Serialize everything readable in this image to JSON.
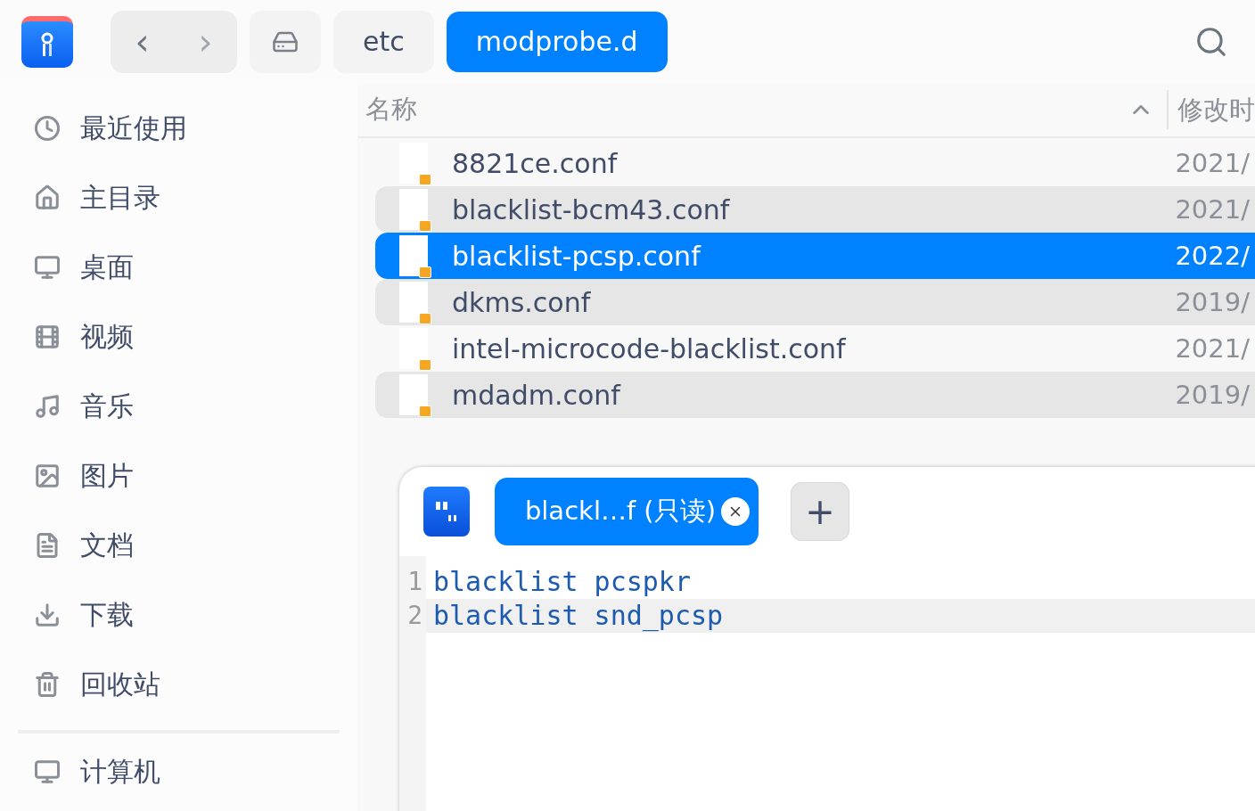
{
  "toolbar": {
    "back": "‹",
    "forward": "›",
    "breadcrumbs": [
      {
        "label": "etc",
        "selected": false
      },
      {
        "label": "modprobe.d",
        "selected": true
      }
    ]
  },
  "sidebar": {
    "items": [
      {
        "kind": "recent",
        "label": "最近使用"
      },
      {
        "kind": "home",
        "label": "主目录"
      },
      {
        "kind": "desktop",
        "label": "桌面"
      },
      {
        "kind": "video",
        "label": "视频"
      },
      {
        "kind": "music",
        "label": "音乐"
      },
      {
        "kind": "pictures",
        "label": "图片"
      },
      {
        "kind": "documents",
        "label": "文档"
      },
      {
        "kind": "downloads",
        "label": "下载"
      },
      {
        "kind": "trash",
        "label": "回收站"
      }
    ],
    "devices": [
      {
        "kind": "computer",
        "label": "计算机"
      }
    ]
  },
  "table": {
    "columns": [
      "名称",
      "修改时"
    ],
    "rows": [
      {
        "name": "8821ce.conf",
        "date": "2021/",
        "selected": false
      },
      {
        "name": "blacklist-bcm43.conf",
        "date": "2021/",
        "selected": false
      },
      {
        "name": "blacklist-pcsp.conf",
        "date": "2022/",
        "selected": true
      },
      {
        "name": "dkms.conf",
        "date": "2019/",
        "selected": false
      },
      {
        "name": "intel-microcode-blacklist.conf",
        "date": "2021/",
        "selected": false
      },
      {
        "name": "mdadm.conf",
        "date": "2019/",
        "selected": false
      }
    ]
  },
  "editor": {
    "tabs": [
      {
        "label": "blackl…f (只读)",
        "selected": true
      }
    ],
    "new_tab": "+",
    "line_numbers": [
      "1",
      "2"
    ],
    "lines": [
      "blacklist pcspkr",
      "blacklist snd_pcsp"
    ]
  }
}
